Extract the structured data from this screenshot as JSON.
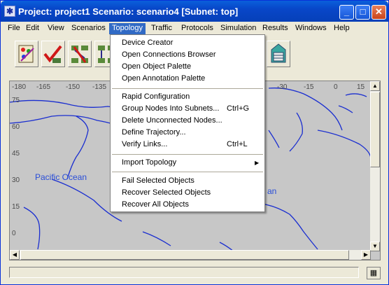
{
  "window": {
    "title": "Project: project1 Scenario: scenario4  [Subnet: top]",
    "app_icon": "✱",
    "minimize": "_",
    "maximize": "□",
    "close": "✕"
  },
  "menubar": [
    "File",
    "Edit",
    "View",
    "Scenarios",
    "Topology",
    "Traffic",
    "Protocols",
    "Simulation",
    "Results",
    "Windows",
    "Help"
  ],
  "active_menu": "Topology",
  "dropdown": {
    "items": [
      {
        "label": "Device Creator",
        "shortcut": ""
      },
      {
        "label": "Open Connections Browser",
        "shortcut": ""
      },
      {
        "label": "Open Object Palette",
        "shortcut": ""
      },
      {
        "label": "Open Annotation Palette",
        "shortcut": ""
      },
      {
        "label": "Rapid Configuration",
        "shortcut": ""
      },
      {
        "label": "Group Nodes Into Subnets...",
        "shortcut": "Ctrl+G"
      },
      {
        "label": "Delete Unconnected Nodes...",
        "shortcut": ""
      },
      {
        "label": "Define Trajectory...",
        "shortcut": ""
      },
      {
        "label": "Verify Links...",
        "shortcut": "Ctrl+L"
      },
      {
        "label": "Import Topology",
        "shortcut": ""
      },
      {
        "label": "Fail Selected Objects",
        "shortcut": ""
      },
      {
        "label": "Recover Selected Objects",
        "shortcut": ""
      },
      {
        "label": "Recover All Objects",
        "shortcut": ""
      }
    ]
  },
  "toolbar": {
    "icons": [
      "object-palette-icon",
      "verify-links-icon",
      "failure-icon",
      "recover-icon",
      "node-icon",
      "browser-icon"
    ]
  },
  "map": {
    "longitudes": [
      "-180",
      "-165",
      "-150",
      "-135",
      "-30",
      "-15",
      "0",
      "15"
    ],
    "latitudes": [
      "75",
      "60",
      "45",
      "30",
      "15",
      "0"
    ],
    "ocean_labels": {
      "pacific": "Pacific Ocean",
      "atlantic": "an"
    },
    "colors": {
      "coastline": "#1a2ed0",
      "background": "#c7c7c7"
    }
  },
  "scroll": {
    "up": "▲",
    "down": "▼",
    "left": "◀",
    "right": "▶"
  },
  "status_icon": "▦"
}
